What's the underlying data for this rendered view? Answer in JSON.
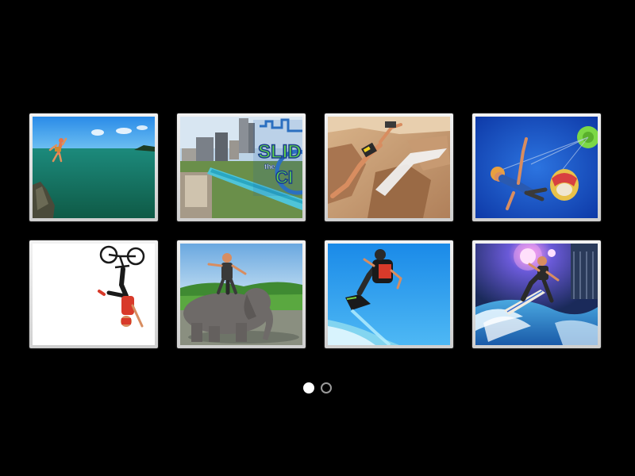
{
  "gallery": {
    "thumbnails": [
      {
        "subject": "cliff-jump",
        "scene_text": ""
      },
      {
        "subject": "slide-the-city",
        "scene_text": [
          "SLID",
          "the",
          "CI"
        ]
      },
      {
        "subject": "rock-climbing",
        "scene_text": ""
      },
      {
        "subject": "paraglider",
        "scene_text": ""
      },
      {
        "subject": "bmx-flip",
        "scene_text": ""
      },
      {
        "subject": "elephant-ride",
        "scene_text": ""
      },
      {
        "subject": "flyboard",
        "scene_text": ""
      },
      {
        "subject": "indoor-surf",
        "scene_text": ""
      }
    ]
  },
  "pager": {
    "pages": 2,
    "active_page": 1
  },
  "colors": {
    "background": "#000000",
    "frame": "#e6e6e6",
    "dot_active": "#ffffff",
    "dot_inactive": "#9a9a9a"
  }
}
